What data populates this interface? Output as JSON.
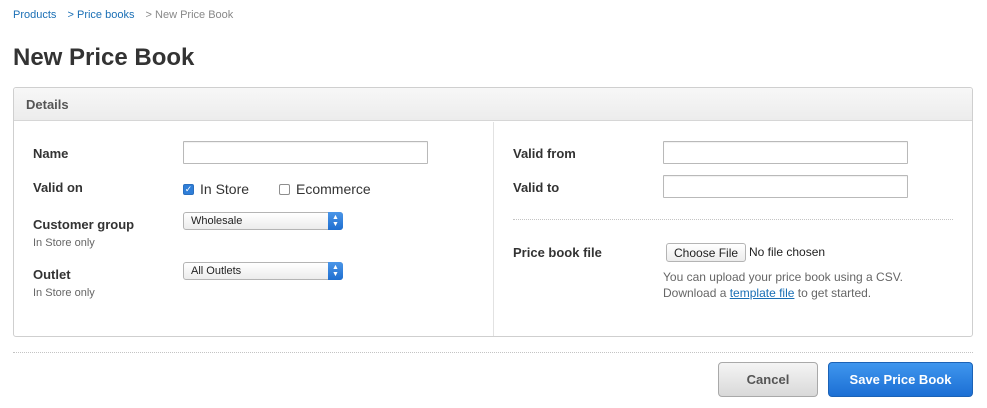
{
  "breadcrumb": {
    "products": "Products",
    "sep1": ">",
    "price_books": "Price books",
    "sep2": ">",
    "current": "New Price Book"
  },
  "page_title": "New Price Book",
  "details": {
    "header": "Details",
    "name": {
      "label": "Name",
      "value": "",
      "placeholder": ""
    },
    "valid_on": {
      "label": "Valid on",
      "in_store": {
        "label": "In Store",
        "checked": true
      },
      "ecommerce": {
        "label": "Ecommerce",
        "checked": false
      }
    },
    "customer_group": {
      "label": "Customer group",
      "sublabel": "In Store only",
      "value": "Wholesale"
    },
    "outlet": {
      "label": "Outlet",
      "sublabel": "In Store only",
      "value": "All Outlets"
    },
    "valid_from": {
      "label": "Valid from",
      "value": ""
    },
    "valid_to": {
      "label": "Valid to",
      "value": ""
    },
    "price_book_file": {
      "label": "Price book file",
      "button": "Choose File",
      "status": "No file chosen",
      "help_line1": "You can upload your price book using a CSV.",
      "help_prefix": "Download a",
      "help_link": "template file",
      "help_suffix": "to get started."
    }
  },
  "actions": {
    "cancel": "Cancel",
    "save": "Save Price Book"
  },
  "colors": {
    "link": "#1a6fb5",
    "primary_button": "#1c6fd4",
    "checkbox_checked": "#2f7ed8"
  },
  "icons": {
    "check": "check-icon",
    "select_arrows": "chevron-updown-icon"
  }
}
